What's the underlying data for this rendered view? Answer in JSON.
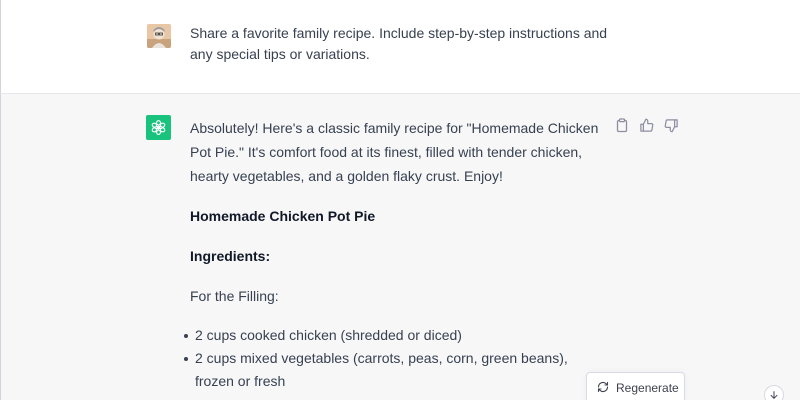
{
  "user_message": {
    "avatar": "user-photo-avatar",
    "text": "Share a favorite family recipe. Include step-by-step instructions and any special tips or variations."
  },
  "assistant_message": {
    "avatar": "openai-logo-icon",
    "intro": "Absolutely! Here's a classic family recipe for \"Homemade Chicken Pot Pie.\" It's comfort food at its finest, filled with tender chicken, hearty vegetables, and a golden flaky crust. Enjoy!",
    "recipe_title": "Homemade Chicken Pot Pie",
    "ingredients_heading": "Ingredients:",
    "filling_heading": "For the Filling:",
    "filling_items": [
      "2 cups cooked chicken (shredded or diced)",
      "2 cups mixed vegetables (carrots, peas, corn, green beans), frozen or fresh"
    ]
  },
  "actions": [
    "copy-icon",
    "thumbs-up-icon",
    "thumbs-down-icon"
  ],
  "regenerate_label": "Regenerate",
  "colors": {
    "accent_green": "#19c37d",
    "assistant_bg": "#f7f7f8",
    "text": "#374151"
  }
}
